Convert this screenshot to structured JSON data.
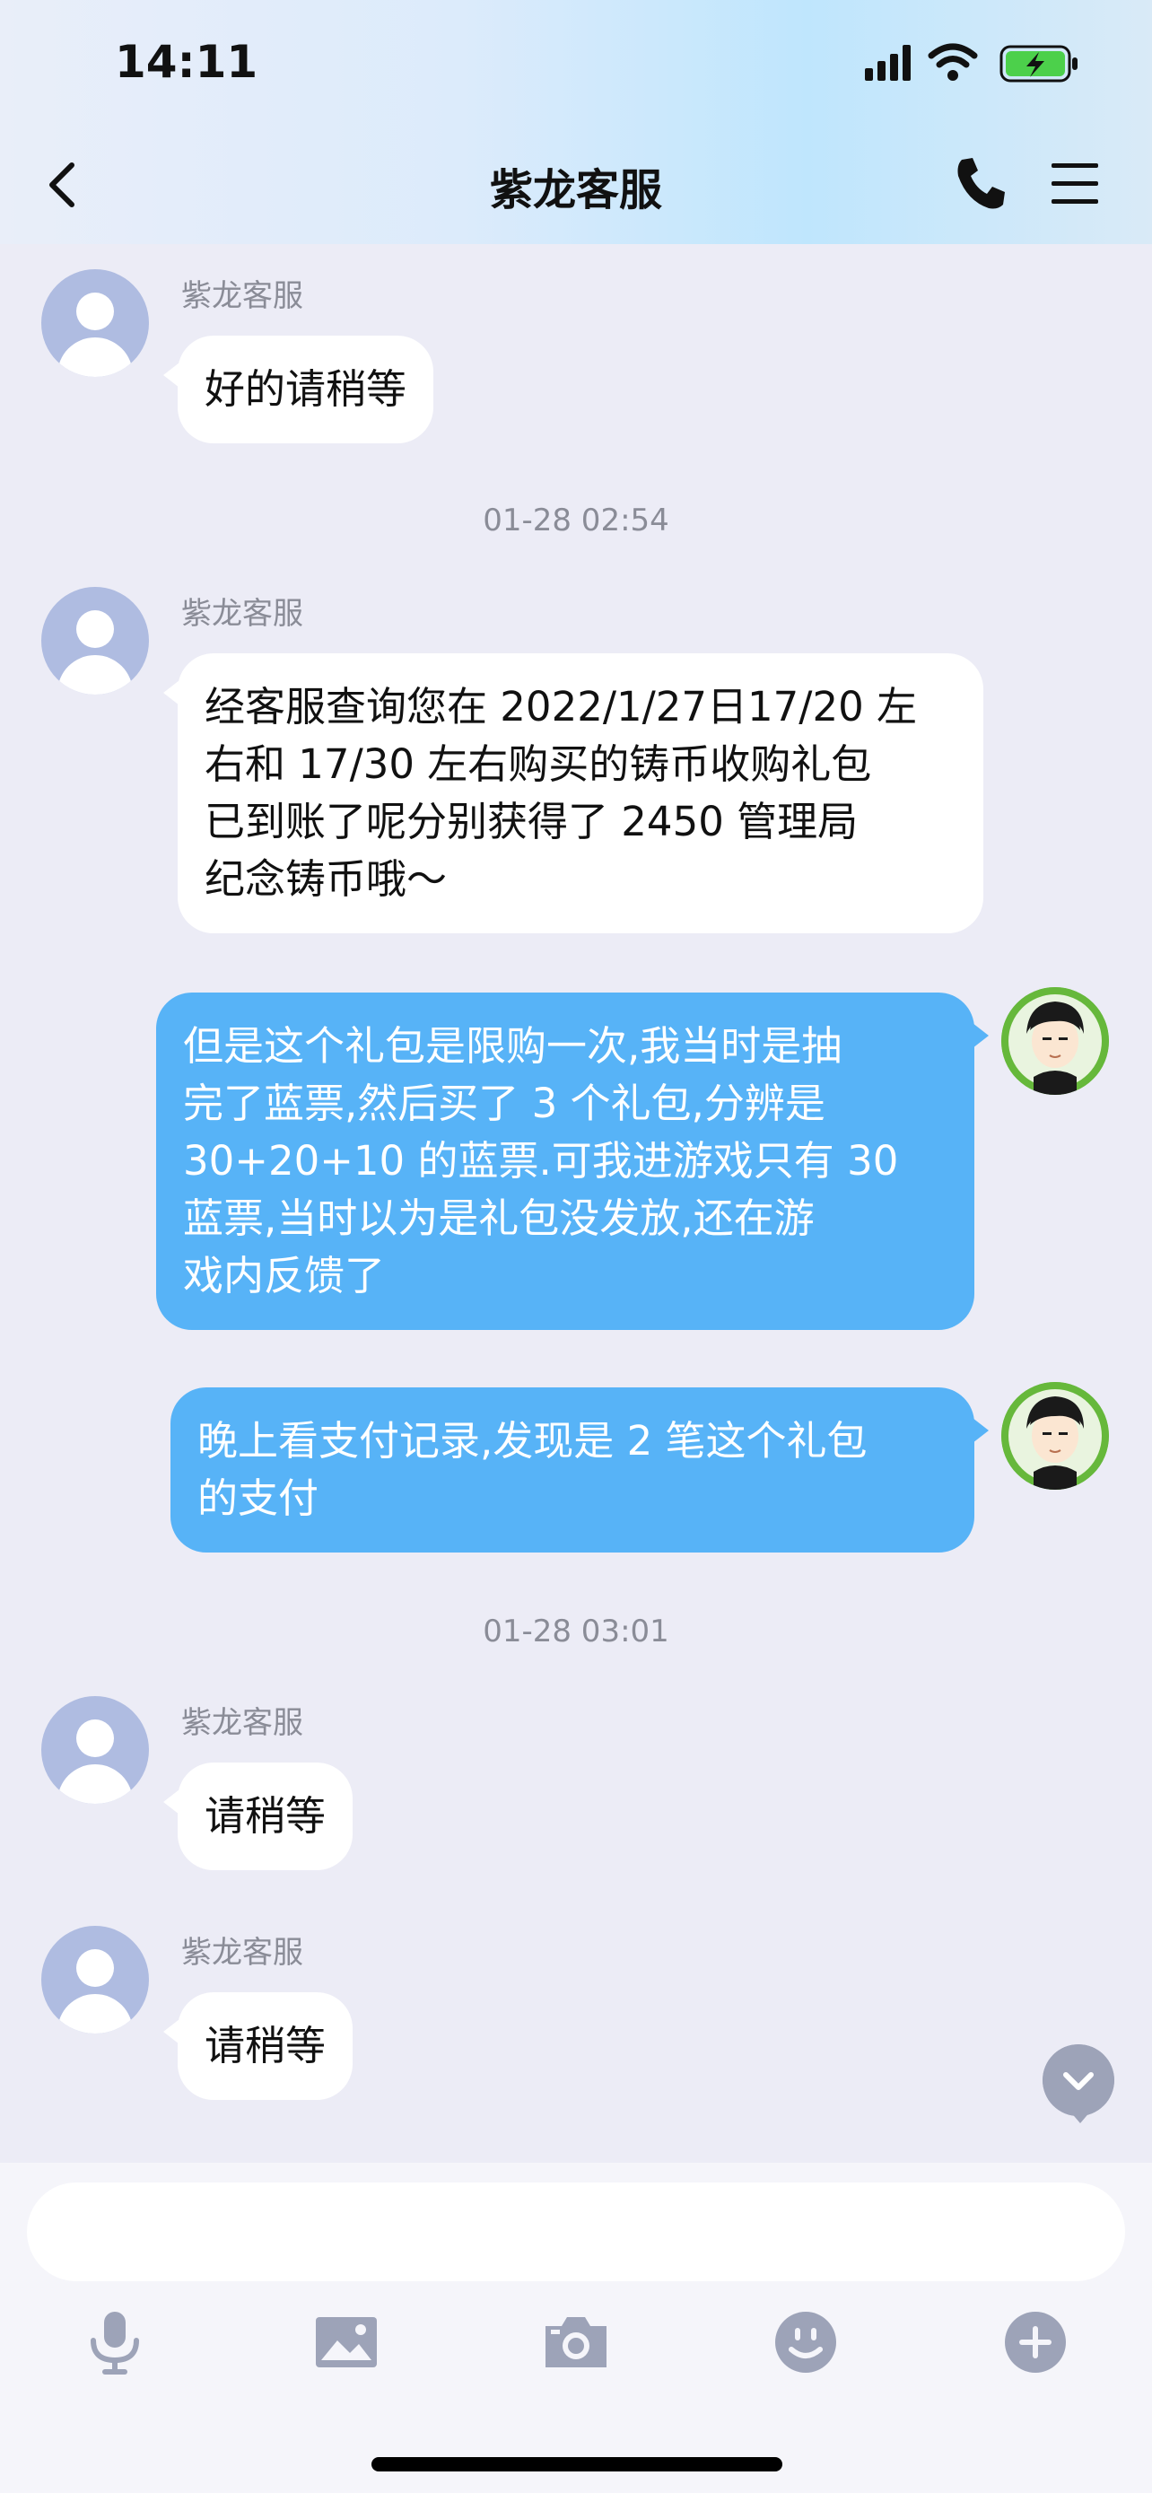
{
  "status_bar": {
    "time": "14:11"
  },
  "header": {
    "title": "紫龙客服"
  },
  "messages": [
    {
      "sender": "紫龙客服",
      "text": "好的请稍等"
    },
    {
      "time": "01-28 02:54"
    },
    {
      "sender": "紫龙客服",
      "lines": [
        "经客服查询您在 2022/1/27日17/20 左",
        "右和 17/30 左右购买的铸币收购礼包",
        "已到账了呢分别获得了 2450 管理局",
        "纪念铸币哦～"
      ]
    },
    {
      "lines": [
        "但是这个礼包是限购一次,我当时是抽",
        "完了蓝票,然后买了 3 个礼包,分辨是",
        "30+20+10 的蓝票.可我进游戏只有 30",
        "蓝票,当时以为是礼包没发放,还在游",
        "戏内反馈了"
      ]
    },
    {
      "lines": [
        "晚上看支付记录,发现是 2 笔这个礼包",
        "的支付"
      ]
    },
    {
      "time": "01-28 03:01"
    },
    {
      "sender": "紫龙客服",
      "text": "请稍等"
    },
    {
      "sender": "紫龙客服",
      "text": "请稍等"
    }
  ],
  "input": {
    "placeholder": ""
  },
  "toolbar": [
    "microphone-icon",
    "image-icon",
    "camera-icon",
    "emoji-icon",
    "plus-icon"
  ],
  "colors": {
    "user_bubble": "#57B3F7",
    "agent_bubble": "#FFFFFF",
    "background": "#ECECF6"
  }
}
